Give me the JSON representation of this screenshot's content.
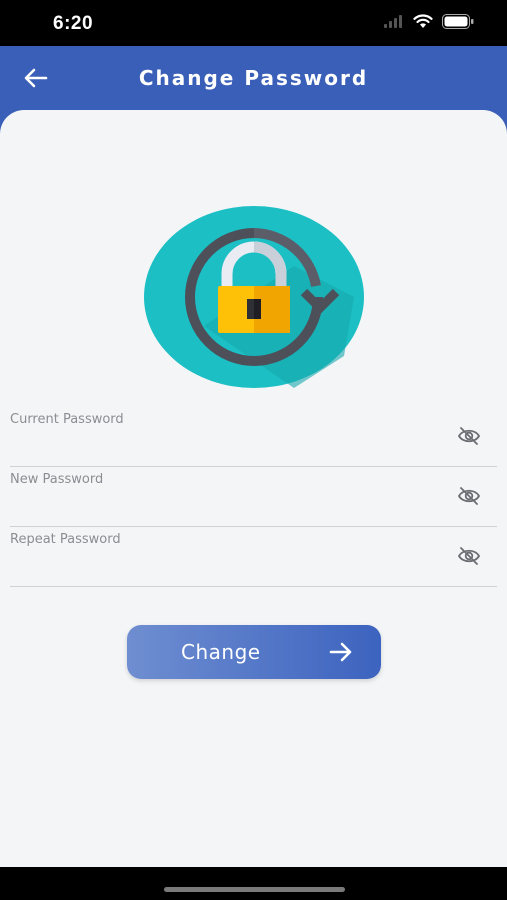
{
  "status_bar": {
    "time": "6:20",
    "icons": [
      "signal-icon",
      "wifi-icon",
      "battery-icon"
    ]
  },
  "header": {
    "title": "Change Password",
    "back_icon": "arrow-left-icon",
    "background_color": "#3a5fb8"
  },
  "illustration": {
    "icon": "lock-refresh-icon"
  },
  "form": {
    "fields": [
      {
        "label": "Current Password",
        "value": "",
        "visibility_icon": "eye-off-icon"
      },
      {
        "label": "New Password",
        "value": "",
        "visibility_icon": "eye-off-icon"
      },
      {
        "label": "Repeat Password",
        "value": "",
        "visibility_icon": "eye-off-icon"
      }
    ]
  },
  "change_button": {
    "label": "Change",
    "icon": "arrow-right-icon"
  }
}
